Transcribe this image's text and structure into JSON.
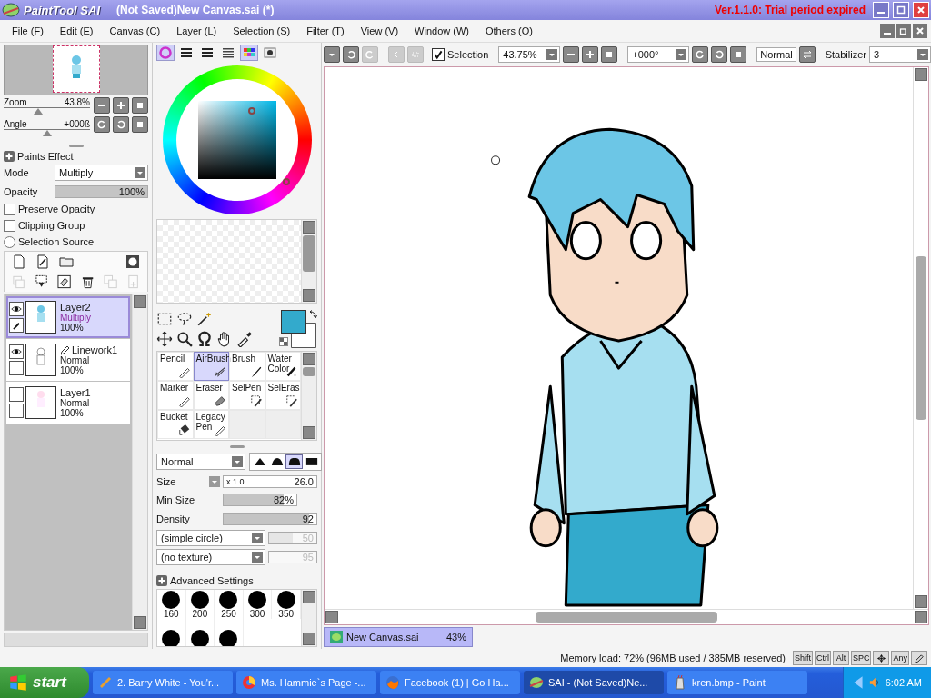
{
  "window": {
    "logo": "PaintTool SAI",
    "title": "(Not Saved)New Canvas.sai (*)",
    "version": "Ver.1.1.0: Trial period expired"
  },
  "menu": [
    "File (F)",
    "Edit (E)",
    "Canvas (C)",
    "Layer (L)",
    "Selection (S)",
    "Filter (T)",
    "View (V)",
    "Window (W)",
    "Others (O)"
  ],
  "navigator": {
    "zoom_label": "Zoom",
    "zoom": "43.8%",
    "zoom_slider": {
      "level": 0.4
    },
    "angle_label": "Angle",
    "angle": "+000ß",
    "angle_slider": {
      "level": 0.5
    }
  },
  "layer_props": {
    "section": "Paints Effect",
    "mode_label": "Mode",
    "mode": "Multiply",
    "opacity_label": "Opacity",
    "opacity": "100%",
    "opacity_slider": {
      "level": 1
    },
    "options": [
      {
        "kind": "checkbox",
        "label": "Preserve Opacity",
        "checked": false
      },
      {
        "kind": "checkbox",
        "label": "Clipping Group",
        "checked": false
      },
      {
        "kind": "radio",
        "label": "Selection Source",
        "checked": false
      }
    ]
  },
  "layers": [
    {
      "name": "Layer2",
      "mode": "Multiply",
      "opacity": "100%",
      "kind": "normal",
      "visible": true,
      "active": true,
      "selected": true
    },
    {
      "name": "Linework1",
      "mode": "Normal",
      "opacity": "100%",
      "kind": "linework",
      "visible": true,
      "active": false,
      "selected": false
    },
    {
      "name": "Layer1",
      "mode": "Normal",
      "opacity": "100%",
      "kind": "normal",
      "visible": false,
      "active": false,
      "selected": false
    }
  ],
  "color_tabs": [
    {
      "kind": "wheel",
      "selected": true
    },
    {
      "kind": "rgb",
      "selected": false
    },
    {
      "kind": "hsv",
      "selected": false
    },
    {
      "kind": "mixer",
      "selected": false
    },
    {
      "kind": "swatches",
      "selected": true
    },
    {
      "kind": "scratch",
      "selected": false
    }
  ],
  "brushes": [
    {
      "name": "Pencil",
      "kind": "pencil",
      "selected": false
    },
    {
      "name": "AirBrush",
      "kind": "airbrush",
      "selected": true
    },
    {
      "name": "Brush",
      "kind": "brush",
      "selected": false
    },
    {
      "name": "Water Color",
      "kind": "water",
      "selected": false
    },
    {
      "name": "Marker",
      "kind": "pencil",
      "selected": false
    },
    {
      "name": "Eraser",
      "kind": "eraser",
      "selected": false
    },
    {
      "name": "SelPen",
      "kind": "selpen",
      "selected": false
    },
    {
      "name": "SelEras",
      "kind": "seleras",
      "selected": false
    },
    {
      "name": "Bucket",
      "kind": "bucket",
      "selected": false
    },
    {
      "name": "Legacy Pen",
      "kind": "pencil",
      "selected": false
    }
  ],
  "brush_settings": {
    "blend": "Normal",
    "shapes": [
      {
        "selected": false
      },
      {
        "selected": false
      },
      {
        "selected": true
      },
      {
        "selected": false
      }
    ],
    "size_label": "Size",
    "size_mult": "x 1.0",
    "size": "26.0",
    "min_size_label": "Min Size",
    "min_size": "82%",
    "min_size_slider": {
      "level": 0.82
    },
    "density_label": "Density",
    "density": "92",
    "density_slider": {
      "level": 0.92
    },
    "shape": "(simple circle)",
    "shape_value": "50",
    "shape_slider": {
      "level": 0.5,
      "disabled": true
    },
    "texture": "(no texture)",
    "texture_value": "95",
    "texture_slider": {
      "disabled": true
    },
    "advanced": "Advanced Settings",
    "sizes": [
      {
        "label": "160"
      },
      {
        "label": "200"
      },
      {
        "label": "250"
      },
      {
        "label": "300"
      },
      {
        "label": "350"
      }
    ]
  },
  "toolbar": {
    "selection_label": "Selection",
    "selection_checked": true,
    "zoom": "43.75%",
    "angle": "+000°",
    "blend": "Normal",
    "stabilizer_label": "Stabilizer",
    "stabilizer": "3"
  },
  "canvas_tabs": [
    {
      "name": "New Canvas.sai",
      "zoom": "43%",
      "selected": true
    }
  ],
  "status": {
    "memory": "Memory load: 72% (96MB used / 385MB reserved)",
    "keys": [
      {
        "kind": "text",
        "label": "Shift"
      },
      {
        "kind": "text",
        "label": "Ctrl"
      },
      {
        "kind": "text",
        "label": "Alt"
      },
      {
        "kind": "text",
        "label": "SPC"
      },
      {
        "kind": "move"
      },
      {
        "kind": "text",
        "label": "Any"
      },
      {
        "kind": "pen"
      }
    ]
  },
  "taskbar": {
    "start": "start",
    "items": [
      {
        "label": "2. Barry White - You'r...",
        "kind": "music",
        "selected": false
      },
      {
        "label": "Ms. Hammie`s Page -...",
        "kind": "browser",
        "selected": false
      },
      {
        "label": "Facebook (1) | Go Ha...",
        "kind": "fox",
        "selected": false
      },
      {
        "label": "SAI - (Not Saved)Ne...",
        "kind": "sai",
        "selected": true
      },
      {
        "label": "kren.bmp - Paint",
        "kind": "paint",
        "selected": false
      }
    ],
    "clock": "6:02 AM"
  }
}
